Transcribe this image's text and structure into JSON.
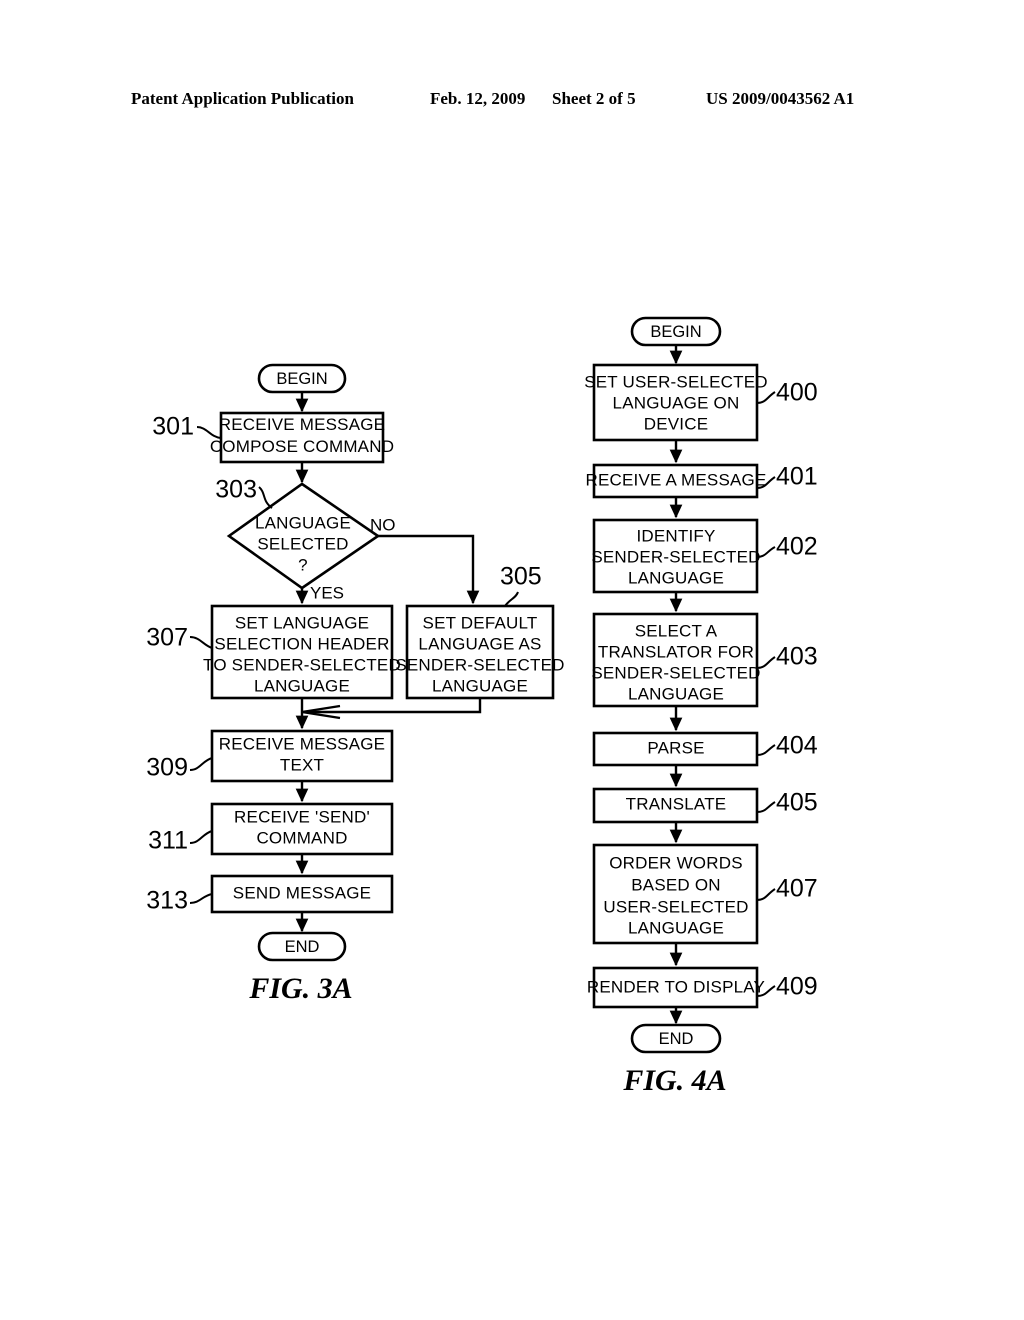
{
  "header": {
    "publication": "Patent Application Publication",
    "date": "Feb. 12, 2009",
    "sheet": "Sheet 2 of 5",
    "patent_number": "US 2009/0043562 A1"
  },
  "figures": [
    {
      "caption": "FIG. 3A",
      "start_label": "BEGIN",
      "end_label": "END",
      "branch_labels": {
        "no": "NO",
        "yes": "YES"
      },
      "nodes": [
        {
          "ref": "301",
          "type": "process",
          "lines": [
            "RECEIVE MESSAGE",
            "COMPOSE COMMAND"
          ]
        },
        {
          "ref": "303",
          "type": "decision",
          "lines": [
            "LANGUAGE",
            "SELECTED",
            "?"
          ]
        },
        {
          "ref": "307",
          "type": "process",
          "lines": [
            "SET LANGUAGE",
            "SELECTION HEADER",
            "TO SENDER-SELECTED",
            "LANGUAGE"
          ]
        },
        {
          "ref": "305",
          "type": "process",
          "lines": [
            "SET DEFAULT",
            "LANGUAGE AS",
            "SENDER-SELECTED",
            "LANGUAGE"
          ]
        },
        {
          "ref": "309",
          "type": "process",
          "lines": [
            "RECEIVE MESSAGE",
            "TEXT"
          ]
        },
        {
          "ref": "311",
          "type": "process",
          "lines": [
            "RECEIVE 'SEND'",
            "COMMAND"
          ]
        },
        {
          "ref": "313",
          "type": "process",
          "lines": [
            "SEND MESSAGE"
          ]
        }
      ]
    },
    {
      "caption": "FIG. 4A",
      "start_label": "BEGIN",
      "end_label": "END",
      "nodes": [
        {
          "ref": "400",
          "type": "process",
          "lines": [
            "SET USER-SELECTED",
            "LANGUAGE ON",
            "DEVICE"
          ]
        },
        {
          "ref": "401",
          "type": "process",
          "lines": [
            "RECEIVE A MESSAGE"
          ]
        },
        {
          "ref": "402",
          "type": "process",
          "lines": [
            "IDENTIFY",
            "SENDER-SELECTED",
            "LANGUAGE"
          ]
        },
        {
          "ref": "403",
          "type": "process",
          "lines": [
            "SELECT A",
            "TRANSLATOR FOR",
            "SENDER-SELECTED",
            "LANGUAGE"
          ]
        },
        {
          "ref": "404",
          "type": "process",
          "lines": [
            "PARSE"
          ]
        },
        {
          "ref": "405",
          "type": "process",
          "lines": [
            "TRANSLATE"
          ]
        },
        {
          "ref": "407",
          "type": "process",
          "lines": [
            "ORDER WORDS",
            "BASED ON",
            "USER-SELECTED",
            "LANGUAGE"
          ]
        },
        {
          "ref": "409",
          "type": "process",
          "lines": [
            "RENDER TO DISPLAY"
          ]
        }
      ]
    }
  ]
}
